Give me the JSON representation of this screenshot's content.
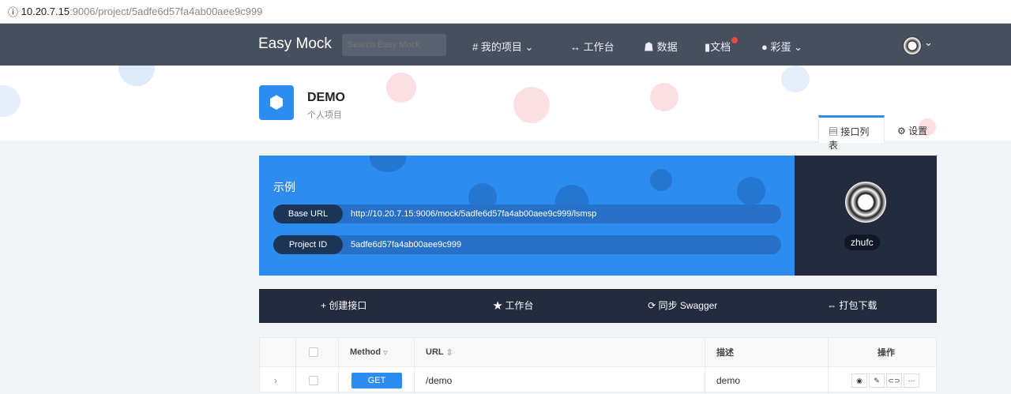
{
  "address_bar": {
    "host": "10.20.7.15",
    "path": ":9006/project/5adfe6d57fa4ab00aee9c999"
  },
  "nav": {
    "logo": "Easy Mock",
    "search_placeholder": "Search Easy Mock",
    "items": [
      "我的项目",
      "工作台",
      "数据",
      "文档",
      "彩蛋"
    ]
  },
  "project": {
    "name": "DEMO",
    "type": "个人项目",
    "tabs": [
      "接口列表",
      "设置"
    ]
  },
  "card": {
    "title": "示例",
    "base_url_label": "Base URL",
    "base_url": "http://10.20.7.15:9006/mock/5adfe6d57fa4ab00aee9c999/lsmsp",
    "project_id_label": "Project ID",
    "project_id": "5adfe6d57fa4ab00aee9c999"
  },
  "user": {
    "name": "zhufc"
  },
  "actions": [
    "创建接口",
    "工作台",
    "同步 Swagger",
    "打包下载"
  ],
  "table": {
    "headers": [
      "Method",
      "URL",
      "描述",
      "操作"
    ],
    "rows": [
      {
        "method": "GET",
        "url": "/demo",
        "desc": "demo"
      }
    ]
  },
  "colors": {
    "accent": "#2d8cf0",
    "nav": "#474f5e",
    "dark": "#242b3f"
  }
}
